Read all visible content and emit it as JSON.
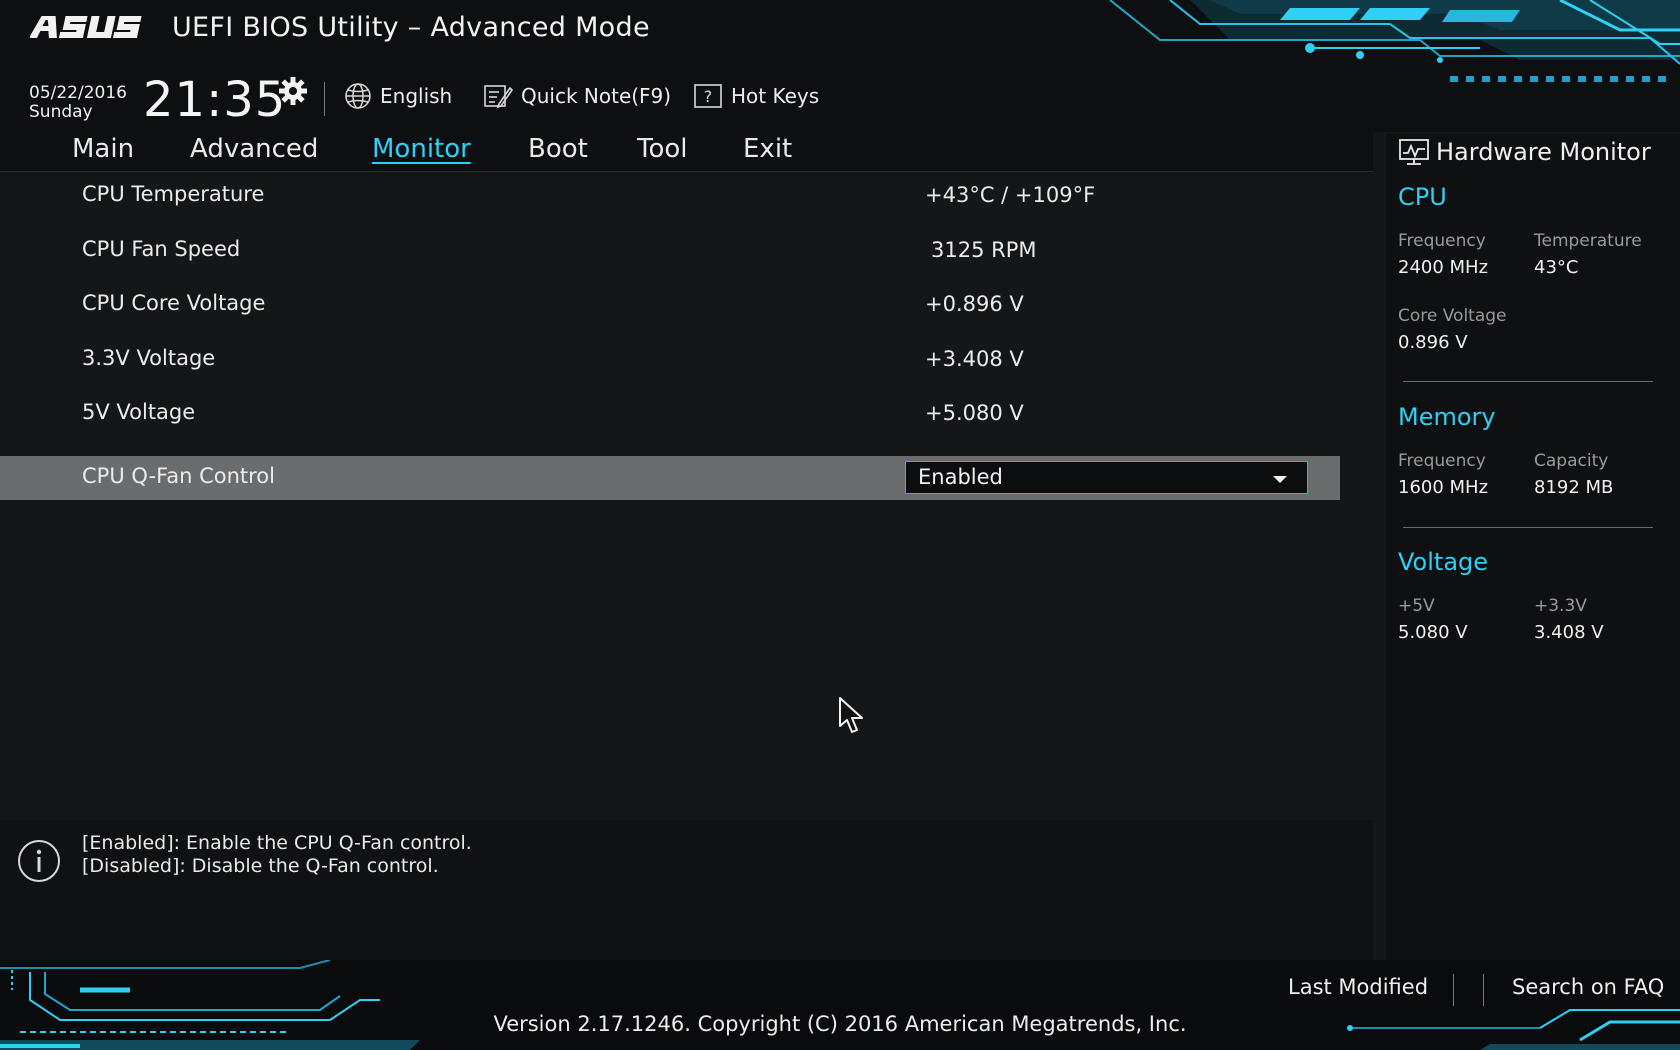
{
  "header": {
    "brand": "ASUS",
    "title": "UEFI BIOS Utility – Advanced Mode",
    "date": "05/22/2016",
    "day": "Sunday",
    "time": "21:35",
    "language": "English",
    "quick_note": "Quick Note(F9)",
    "hot_keys": "Hot Keys"
  },
  "tabs": [
    {
      "label": "Main",
      "active": false
    },
    {
      "label": "Advanced",
      "active": false
    },
    {
      "label": "Monitor",
      "active": true
    },
    {
      "label": "Boot",
      "active": false
    },
    {
      "label": "Tool",
      "active": false
    },
    {
      "label": "Exit",
      "active": false
    }
  ],
  "settings": [
    {
      "label": "CPU Temperature",
      "value": "+43°C / +109°F"
    },
    {
      "label": "CPU Fan Speed",
      "value": "3125 RPM"
    },
    {
      "label": "CPU Core Voltage",
      "value": "+0.896 V"
    },
    {
      "label": "3.3V Voltage",
      "value": "+3.408 V"
    },
    {
      "label": "5V Voltage",
      "value": "+5.080 V"
    },
    {
      "label": "CPU Q-Fan Control",
      "value": "Enabled",
      "selected": true
    }
  ],
  "help": {
    "line1": "[Enabled]: Enable the CPU Q-Fan control.",
    "line2": "[Disabled]: Disable the Q-Fan control."
  },
  "hardware_monitor": {
    "title": "Hardware Monitor",
    "cpu": {
      "heading": "CPU",
      "frequency_label": "Frequency",
      "frequency": "2400 MHz",
      "temperature_label": "Temperature",
      "temperature": "43°C",
      "core_voltage_label": "Core Voltage",
      "core_voltage": "0.896 V"
    },
    "memory": {
      "heading": "Memory",
      "frequency_label": "Frequency",
      "frequency": "1600 MHz",
      "capacity_label": "Capacity",
      "capacity": "8192 MB"
    },
    "voltage": {
      "heading": "Voltage",
      "v5_label": "+5V",
      "v5": "5.080 V",
      "v33_label": "+3.3V",
      "v33": "3.408 V"
    }
  },
  "footer": {
    "last_modified": "Last Modified",
    "search_faq": "Search on FAQ",
    "copyright": "Version 2.17.1246. Copyright (C) 2016 American Megatrends, Inc."
  },
  "colors": {
    "accent": "#2fd0f4",
    "background": "#151617",
    "selected_row": "#6b6c6d"
  }
}
